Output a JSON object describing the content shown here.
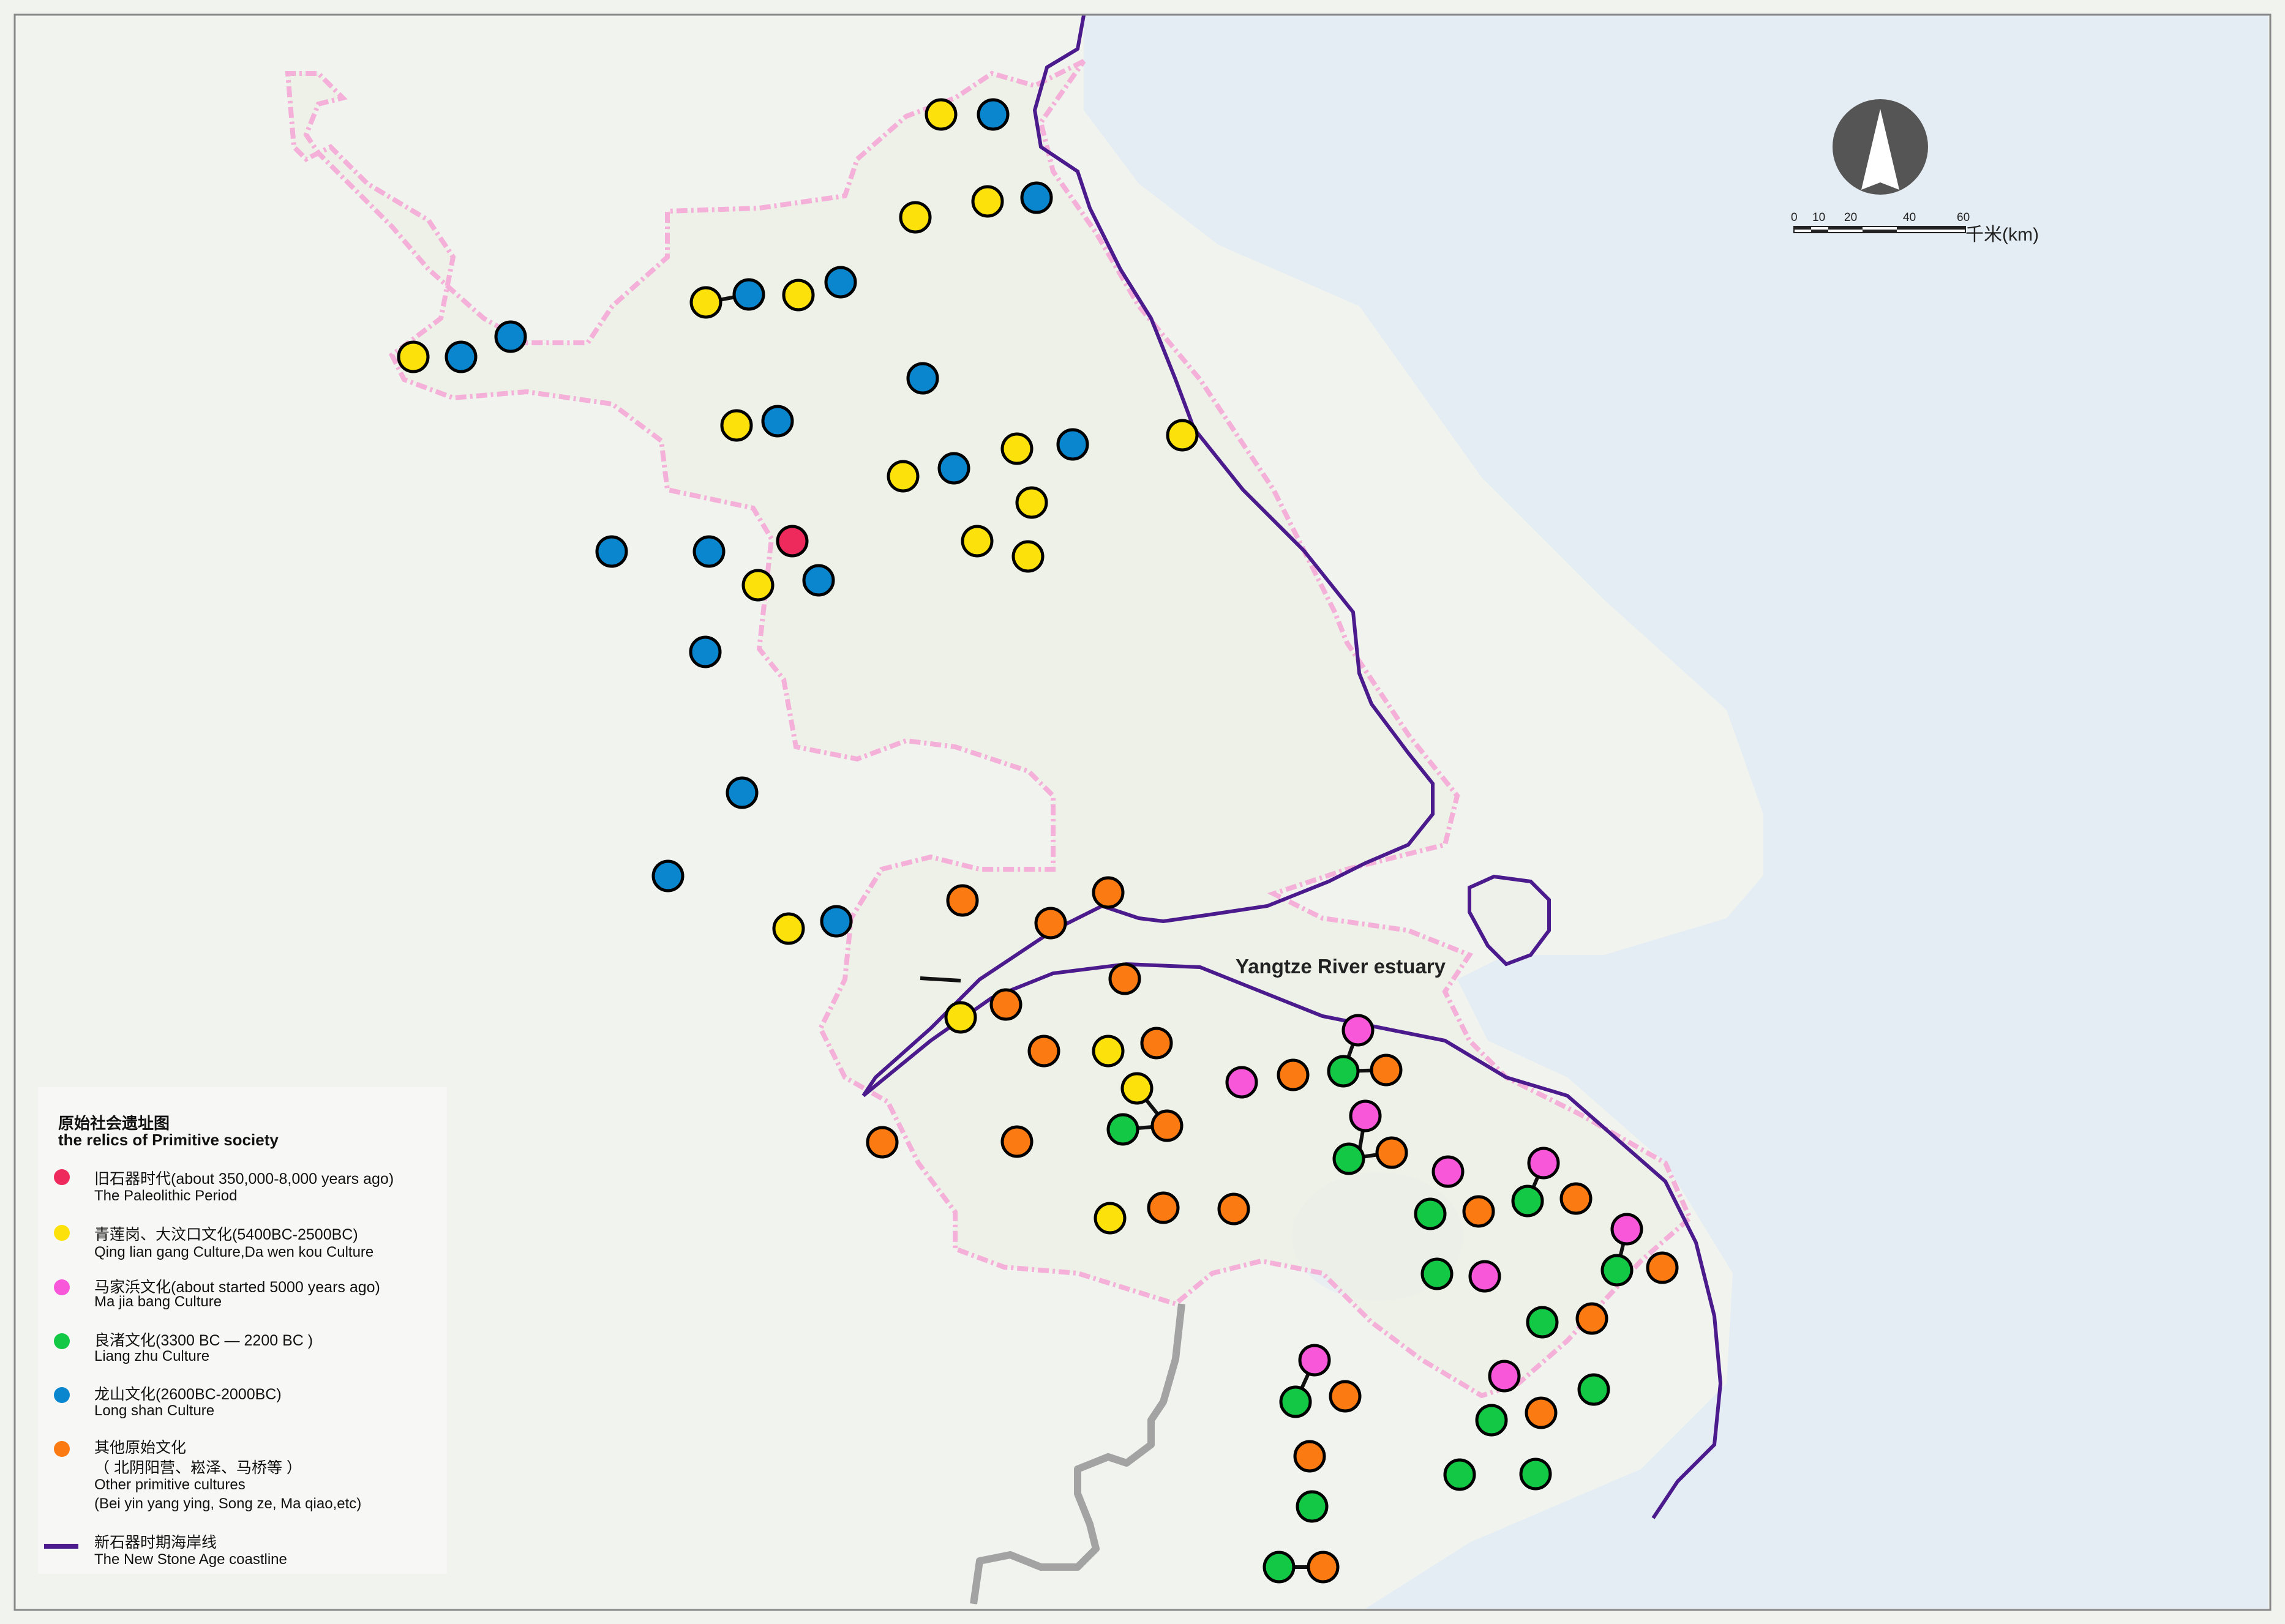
{
  "map": {
    "estuary_label": "Yangtze River estuary",
    "colors": {
      "sea": "#e6eef5",
      "land": "#f2f4ef",
      "province_border": "#f2a9d6",
      "coastline": "#4b1a8c",
      "road": "#9a9a9a",
      "paleolithic": "#ee2a5c",
      "qinglian": "#fde10a",
      "majiabang": "#f857d9",
      "liangzhu": "#13c845",
      "longshan": "#0a86cf",
      "other": "#fb7a12"
    }
  },
  "legend": {
    "title_zh": "原始社会遗址图",
    "title_en": "the relics of Primitive society",
    "items": [
      {
        "zh": "旧石器时代(about 350,000-8,000 years ago)",
        "en": "The Paleolithic Period",
        "color": "#ee2a5c"
      },
      {
        "zh": "青莲岗、大汶口文化(5400BC-2500BC)",
        "en": "Qing lian gang Culture,Da wen kou Culture",
        "color": "#fde10a"
      },
      {
        "zh": "马家浜文化(about started 5000 years ago)",
        "en": "Ma jia bang Culture",
        "color": "#f857d9"
      },
      {
        "zh": "良渚文化(3300 BC — 2200 BC )",
        "en": "Liang zhu Culture",
        "color": "#13c845"
      },
      {
        "zh": "龙山文化(2600BC-2000BC)",
        "en": "Long shan Culture",
        "color": "#0a86cf"
      },
      {
        "zh": "其他原始文化",
        "zh2": "（ 北阴阳营、崧泽、马桥等 ）",
        "en": "Other primitive cultures",
        "en2": "(Bei yin yang ying, Song ze, Ma qiao,etc)",
        "color": "#fb7a12"
      }
    ],
    "coastline_zh": "新石器时期海岸线",
    "coastline_en": "The New Stone Age coastline"
  },
  "scale": {
    "ticks": [
      "0",
      "10",
      "20",
      "40",
      "60"
    ],
    "unit": "千米(km)"
  },
  "compass": {
    "icon": "north-arrow-icon"
  }
}
